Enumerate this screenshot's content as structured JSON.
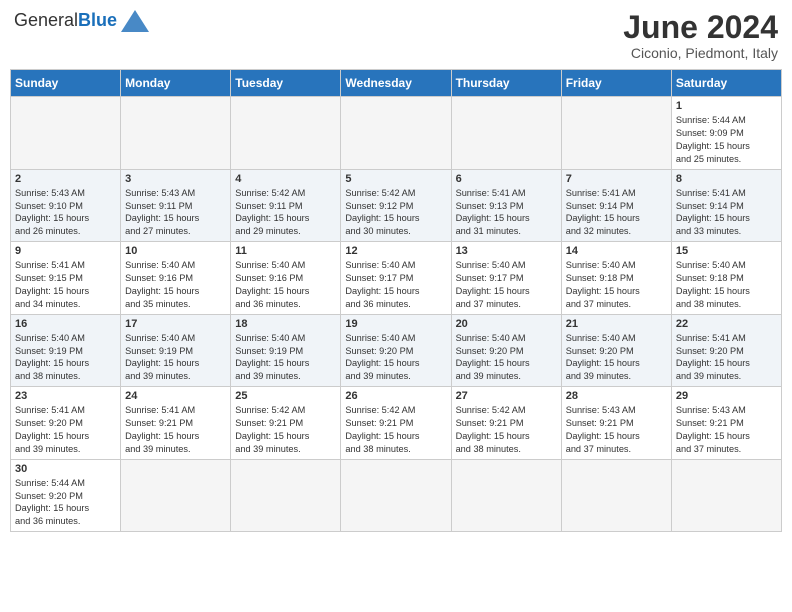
{
  "logo": {
    "general": "General",
    "blue": "Blue"
  },
  "header": {
    "month": "June 2024",
    "location": "Ciconio, Piedmont, Italy"
  },
  "weekdays": [
    "Sunday",
    "Monday",
    "Tuesday",
    "Wednesday",
    "Thursday",
    "Friday",
    "Saturday"
  ],
  "weeks": [
    [
      {
        "day": "",
        "info": ""
      },
      {
        "day": "",
        "info": ""
      },
      {
        "day": "",
        "info": ""
      },
      {
        "day": "",
        "info": ""
      },
      {
        "day": "",
        "info": ""
      },
      {
        "day": "",
        "info": ""
      },
      {
        "day": "1",
        "info": "Sunrise: 5:44 AM\nSunset: 9:09 PM\nDaylight: 15 hours\nand 25 minutes."
      }
    ],
    [
      {
        "day": "2",
        "info": "Sunrise: 5:43 AM\nSunset: 9:10 PM\nDaylight: 15 hours\nand 26 minutes."
      },
      {
        "day": "3",
        "info": "Sunrise: 5:43 AM\nSunset: 9:11 PM\nDaylight: 15 hours\nand 27 minutes."
      },
      {
        "day": "4",
        "info": "Sunrise: 5:42 AM\nSunset: 9:11 PM\nDaylight: 15 hours\nand 29 minutes."
      },
      {
        "day": "5",
        "info": "Sunrise: 5:42 AM\nSunset: 9:12 PM\nDaylight: 15 hours\nand 30 minutes."
      },
      {
        "day": "6",
        "info": "Sunrise: 5:41 AM\nSunset: 9:13 PM\nDaylight: 15 hours\nand 31 minutes."
      },
      {
        "day": "7",
        "info": "Sunrise: 5:41 AM\nSunset: 9:14 PM\nDaylight: 15 hours\nand 32 minutes."
      },
      {
        "day": "8",
        "info": "Sunrise: 5:41 AM\nSunset: 9:14 PM\nDaylight: 15 hours\nand 33 minutes."
      }
    ],
    [
      {
        "day": "9",
        "info": "Sunrise: 5:41 AM\nSunset: 9:15 PM\nDaylight: 15 hours\nand 34 minutes."
      },
      {
        "day": "10",
        "info": "Sunrise: 5:40 AM\nSunset: 9:16 PM\nDaylight: 15 hours\nand 35 minutes."
      },
      {
        "day": "11",
        "info": "Sunrise: 5:40 AM\nSunset: 9:16 PM\nDaylight: 15 hours\nand 36 minutes."
      },
      {
        "day": "12",
        "info": "Sunrise: 5:40 AM\nSunset: 9:17 PM\nDaylight: 15 hours\nand 36 minutes."
      },
      {
        "day": "13",
        "info": "Sunrise: 5:40 AM\nSunset: 9:17 PM\nDaylight: 15 hours\nand 37 minutes."
      },
      {
        "day": "14",
        "info": "Sunrise: 5:40 AM\nSunset: 9:18 PM\nDaylight: 15 hours\nand 37 minutes."
      },
      {
        "day": "15",
        "info": "Sunrise: 5:40 AM\nSunset: 9:18 PM\nDaylight: 15 hours\nand 38 minutes."
      }
    ],
    [
      {
        "day": "16",
        "info": "Sunrise: 5:40 AM\nSunset: 9:19 PM\nDaylight: 15 hours\nand 38 minutes."
      },
      {
        "day": "17",
        "info": "Sunrise: 5:40 AM\nSunset: 9:19 PM\nDaylight: 15 hours\nand 39 minutes."
      },
      {
        "day": "18",
        "info": "Sunrise: 5:40 AM\nSunset: 9:19 PM\nDaylight: 15 hours\nand 39 minutes."
      },
      {
        "day": "19",
        "info": "Sunrise: 5:40 AM\nSunset: 9:20 PM\nDaylight: 15 hours\nand 39 minutes."
      },
      {
        "day": "20",
        "info": "Sunrise: 5:40 AM\nSunset: 9:20 PM\nDaylight: 15 hours\nand 39 minutes."
      },
      {
        "day": "21",
        "info": "Sunrise: 5:40 AM\nSunset: 9:20 PM\nDaylight: 15 hours\nand 39 minutes."
      },
      {
        "day": "22",
        "info": "Sunrise: 5:41 AM\nSunset: 9:20 PM\nDaylight: 15 hours\nand 39 minutes."
      }
    ],
    [
      {
        "day": "23",
        "info": "Sunrise: 5:41 AM\nSunset: 9:20 PM\nDaylight: 15 hours\nand 39 minutes."
      },
      {
        "day": "24",
        "info": "Sunrise: 5:41 AM\nSunset: 9:21 PM\nDaylight: 15 hours\nand 39 minutes."
      },
      {
        "day": "25",
        "info": "Sunrise: 5:42 AM\nSunset: 9:21 PM\nDaylight: 15 hours\nand 39 minutes."
      },
      {
        "day": "26",
        "info": "Sunrise: 5:42 AM\nSunset: 9:21 PM\nDaylight: 15 hours\nand 38 minutes."
      },
      {
        "day": "27",
        "info": "Sunrise: 5:42 AM\nSunset: 9:21 PM\nDaylight: 15 hours\nand 38 minutes."
      },
      {
        "day": "28",
        "info": "Sunrise: 5:43 AM\nSunset: 9:21 PM\nDaylight: 15 hours\nand 37 minutes."
      },
      {
        "day": "29",
        "info": "Sunrise: 5:43 AM\nSunset: 9:21 PM\nDaylight: 15 hours\nand 37 minutes."
      }
    ],
    [
      {
        "day": "30",
        "info": "Sunrise: 5:44 AM\nSunset: 9:20 PM\nDaylight: 15 hours\nand 36 minutes."
      },
      {
        "day": "",
        "info": ""
      },
      {
        "day": "",
        "info": ""
      },
      {
        "day": "",
        "info": ""
      },
      {
        "day": "",
        "info": ""
      },
      {
        "day": "",
        "info": ""
      },
      {
        "day": "",
        "info": ""
      }
    ]
  ]
}
